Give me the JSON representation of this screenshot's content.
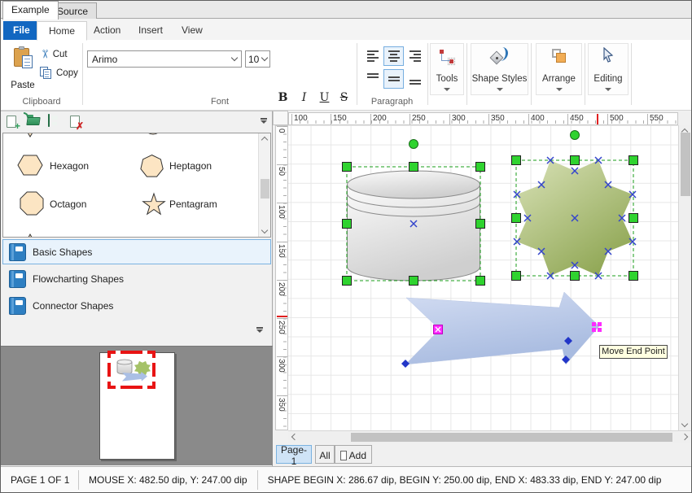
{
  "doc_tabs": [
    {
      "label": "Example",
      "active": true
    },
    {
      "label": "Source",
      "active": false
    }
  ],
  "ribbon": {
    "tabs": [
      {
        "label": "File"
      },
      {
        "label": "Home"
      },
      {
        "label": "Action"
      },
      {
        "label": "Insert"
      },
      {
        "label": "View"
      }
    ],
    "clipboard": {
      "label": "Clipboard",
      "paste": "Paste",
      "cut": "Cut",
      "copy": "Copy"
    },
    "font": {
      "label": "Font",
      "family": "Arimo",
      "size": "10",
      "bold": "B",
      "italic": "I",
      "underline": "U",
      "strike": "S"
    },
    "paragraph": {
      "label": "Paragraph"
    },
    "tools": {
      "label": "Tools"
    },
    "shape_styles": {
      "label": "Shape Styles"
    },
    "arrange": {
      "label": "Arrange"
    },
    "editing": {
      "label": "Editing"
    }
  },
  "library": {
    "shapes": [
      {
        "name": "Hexagon"
      },
      {
        "name": "Heptagon"
      },
      {
        "name": "Octagon"
      },
      {
        "name": "Pentagram"
      }
    ],
    "categories": [
      {
        "name": "Basic Shapes",
        "selected": true
      },
      {
        "name": "Flowcharting Shapes",
        "selected": false
      },
      {
        "name": "Connector Shapes",
        "selected": false
      }
    ]
  },
  "canvas": {
    "ruler_h": [
      "100",
      "150",
      "200",
      "250",
      "300",
      "350",
      "400",
      "450",
      "500",
      "550"
    ],
    "ruler_v": [
      "0",
      "50",
      "100",
      "150",
      "200",
      "250",
      "300",
      "350"
    ],
    "tooltip": "Move End Point"
  },
  "pages": {
    "tabs": [
      {
        "label": "Page-1",
        "selected": true
      },
      {
        "label": "All",
        "selected": false
      },
      {
        "label": "Add",
        "selected": false
      }
    ]
  },
  "status": {
    "page": "PAGE 1 OF 1",
    "mouse": "MOUSE X: 482.50 dip, Y: 247.00 dip",
    "shape": "SHAPE BEGIN X: 286.67 dip, BEGIN Y: 250.00 dip, END X: 483.33 dip, END Y: 247.00 dip"
  },
  "colors": {
    "accent_blue": "#1267c1",
    "handle_green": "#2fd32f",
    "selection_green": "#1a9c1a",
    "magenta": "#ff2bff",
    "diamond_blue": "#2236c8",
    "tooltip_bg": "#ffffe1",
    "shape_peach": "#fce5c3"
  }
}
